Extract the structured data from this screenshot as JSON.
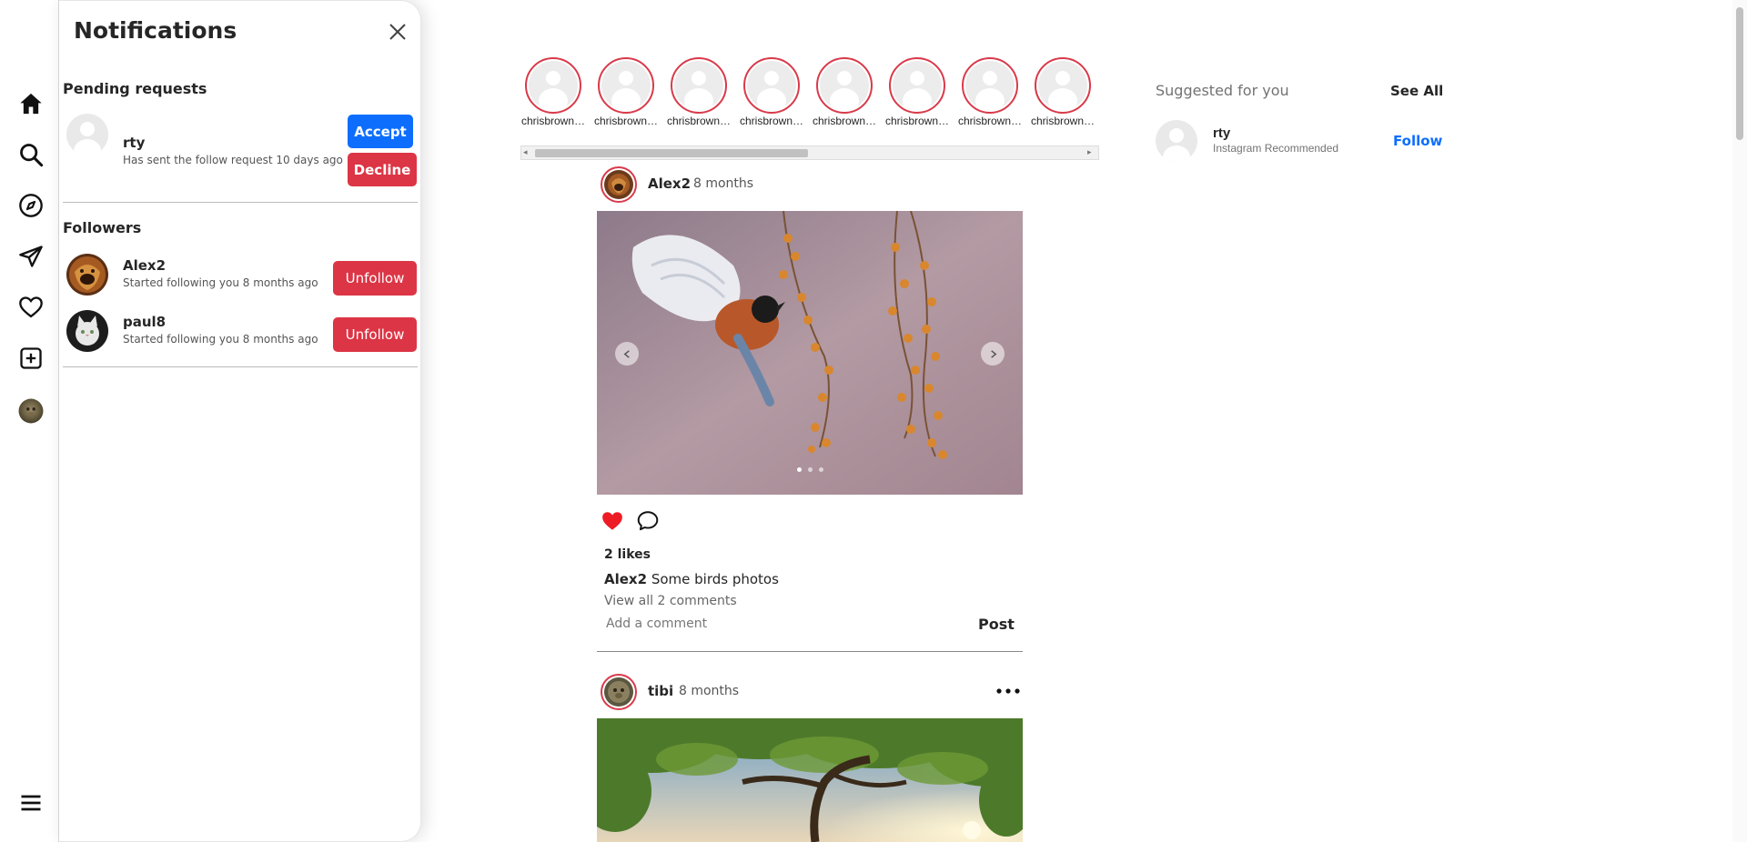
{
  "nav": {
    "items": [
      "home-icon",
      "search-icon",
      "explore-icon",
      "messages-icon",
      "notifications-icon",
      "create-icon",
      "profile-avatar"
    ],
    "menu_icon": "menu-icon"
  },
  "notifications": {
    "title": "Notifications",
    "pending_title": "Pending requests",
    "pending": [
      {
        "username": "rty",
        "text": "Has sent the follow request 10 days ago",
        "accept": "Accept",
        "decline": "Decline"
      }
    ],
    "followers_title": "Followers",
    "followers": [
      {
        "username": "Alex2",
        "text": "Started following you 8 months ago",
        "action": "Unfollow"
      },
      {
        "username": "paul8",
        "text": "Started following you 8 months ago",
        "action": "Unfollow"
      }
    ]
  },
  "stories": [
    "chrisbrown…",
    "chrisbrown…",
    "chrisbrown…",
    "chrisbrown…",
    "chrisbrown…",
    "chrisbrown…",
    "chrisbrown…",
    "chrisbrown…"
  ],
  "posts": [
    {
      "username": "Alex2",
      "time": "8 months",
      "likes": "2 likes",
      "caption_user": "Alex2",
      "caption_text": "Some birds photos",
      "view_comments": "View all 2 comments",
      "comment_placeholder": "Add a comment",
      "post_label": "Post",
      "liked": true
    },
    {
      "username": "tibi",
      "time": "8 months"
    }
  ],
  "suggested": {
    "title": "Suggested for you",
    "see_all": "See All",
    "users": [
      {
        "username": "rty",
        "subtitle": "Instagram Recommended",
        "action": "Follow"
      }
    ]
  },
  "colors": {
    "accent": "#0d6efd",
    "danger": "#dc3545",
    "story_ring": "#d93a4a",
    "like": "#ed1c24"
  }
}
